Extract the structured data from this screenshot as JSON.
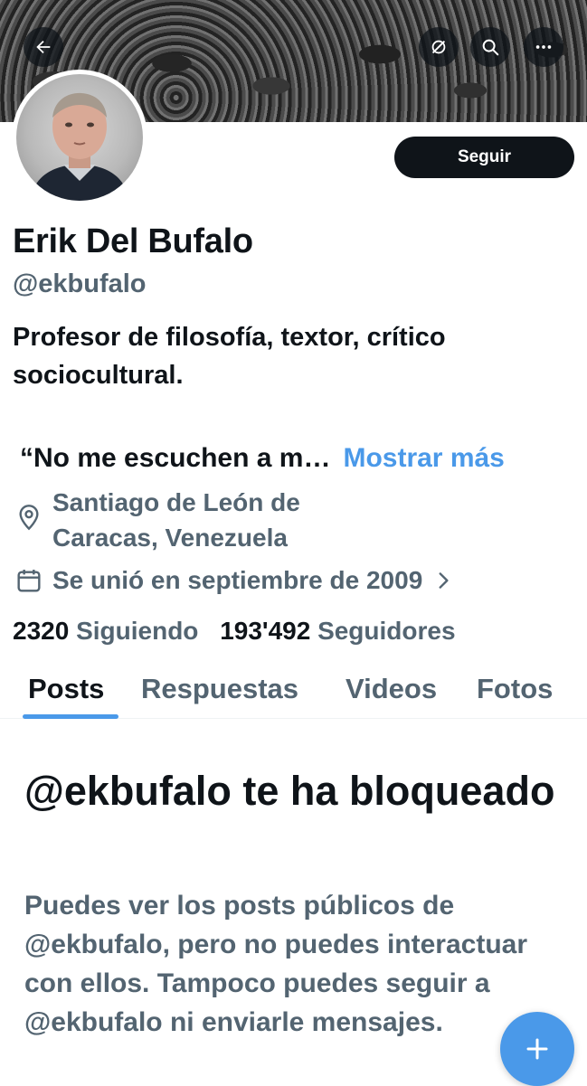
{
  "profile": {
    "name": "Erik Del Bufalo",
    "handle": "@ekbufalo",
    "bio": "Profesor de filosofía, textor, crítico sociocultural.",
    "quote_truncated": "“No me escuchen a m…",
    "show_more": "Mostrar más",
    "location_line1": "Santiago de León de",
    "location_line2": "Caracas, Venezuela",
    "joined": "Se unió en septiembre de 2009",
    "following_count": "2320",
    "following_label": "Siguiendo",
    "followers_count": "193'492",
    "followers_label": "Seguidores"
  },
  "header": {
    "back_icon": "arrow-left-icon",
    "grok_icon": "grok-icon",
    "search_icon": "search-icon",
    "more_icon": "more-dots-icon"
  },
  "actions": {
    "follow_label": "Seguir"
  },
  "tabs": [
    {
      "label": "Posts",
      "active": true
    },
    {
      "label": "Respuestas",
      "active": false
    },
    {
      "label": "Videos",
      "active": false
    },
    {
      "label": "Fotos",
      "active": false
    }
  ],
  "blocked": {
    "title": "@ekbufalo te ha bloqueado",
    "message": "Puedes ver los posts públicos de @ekbufalo, pero no puedes interactuar con ellos. Tampoco puedes seguir a @ekbufalo ni enviarle mensajes."
  },
  "colors": {
    "accent": "#4a99e9",
    "text": "#0f1419",
    "secondary": "#536471"
  }
}
